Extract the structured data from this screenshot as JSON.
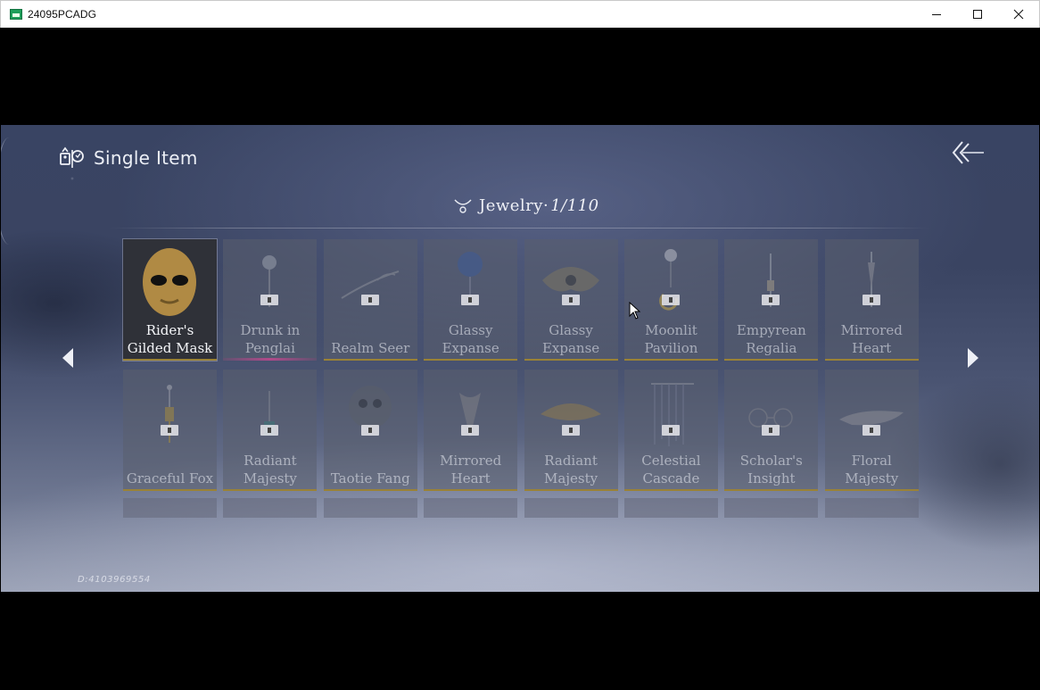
{
  "window": {
    "title": "24095PCADG",
    "icon": "app-icon",
    "controls": [
      "minimize-icon",
      "maximize-icon",
      "close-icon"
    ]
  },
  "header": {
    "title": "Single Item",
    "icon": "costume-icon"
  },
  "back_button": {
    "icon": "double-chevron-back-icon"
  },
  "category": {
    "label": "Jewelry",
    "separator": "·",
    "count": "1/110",
    "icon": "necklace-icon"
  },
  "nav": {
    "prev_icon": "triangle-left-icon",
    "next_icon": "triangle-right-icon"
  },
  "items": [
    {
      "name": "Rider's Gilded Mask",
      "line1": "Rider's",
      "line2": "Gilded Mask",
      "selected": true,
      "rarity": "gold"
    },
    {
      "name": "Drunk in Penglai",
      "line1": "Drunk in",
      "line2": "Penglai",
      "selected": false,
      "rarity": "pink"
    },
    {
      "name": "Realm Seer",
      "line1": "",
      "line2": "Realm Seer",
      "selected": false,
      "rarity": "gold"
    },
    {
      "name": "Glassy Expanse",
      "line1": "Glassy",
      "line2": "Expanse",
      "selected": false,
      "rarity": "gold"
    },
    {
      "name": "Glassy Expanse",
      "line1": "Glassy",
      "line2": "Expanse",
      "selected": false,
      "rarity": "gold"
    },
    {
      "name": "Moonlit Pavilion",
      "line1": "Moonlit",
      "line2": "Pavilion",
      "selected": false,
      "rarity": "gold"
    },
    {
      "name": "Empyrean Regalia",
      "line1": "Empyrean",
      "line2": "Regalia",
      "selected": false,
      "rarity": "gold"
    },
    {
      "name": "Mirrored Heart",
      "line1": "Mirrored",
      "line2": "Heart",
      "selected": false,
      "rarity": "gold"
    },
    {
      "name": "Graceful Fox",
      "line1": "",
      "line2": "Graceful Fox",
      "selected": false,
      "rarity": "gold"
    },
    {
      "name": "Radiant Majesty",
      "line1": "Radiant",
      "line2": "Majesty",
      "selected": false,
      "rarity": "gold"
    },
    {
      "name": "Taotie Fang",
      "line1": "",
      "line2": "Taotie Fang",
      "selected": false,
      "rarity": "gold"
    },
    {
      "name": "Mirrored Heart",
      "line1": "Mirrored",
      "line2": "Heart",
      "selected": false,
      "rarity": "gold"
    },
    {
      "name": "Radiant Majesty",
      "line1": "Radiant",
      "line2": "Majesty",
      "selected": false,
      "rarity": "gold"
    },
    {
      "name": "Celestial Cascade",
      "line1": "Celestial",
      "line2": "Cascade",
      "selected": false,
      "rarity": "gold"
    },
    {
      "name": "Scholar's Insight",
      "line1": "Scholar's",
      "line2": "Insight",
      "selected": false,
      "rarity": "gold"
    },
    {
      "name": "Floral Majesty",
      "line1": "Floral",
      "line2": "Majesty",
      "selected": false,
      "rarity": "gold"
    }
  ],
  "partial_row_count": 8,
  "uid": "D:4103969554",
  "colors": {
    "rarity_gold": "#9a8236",
    "rarity_pink": "#b04a8a",
    "cell_bg": "#5a5e6e",
    "selected_bg": "#2f3138"
  }
}
